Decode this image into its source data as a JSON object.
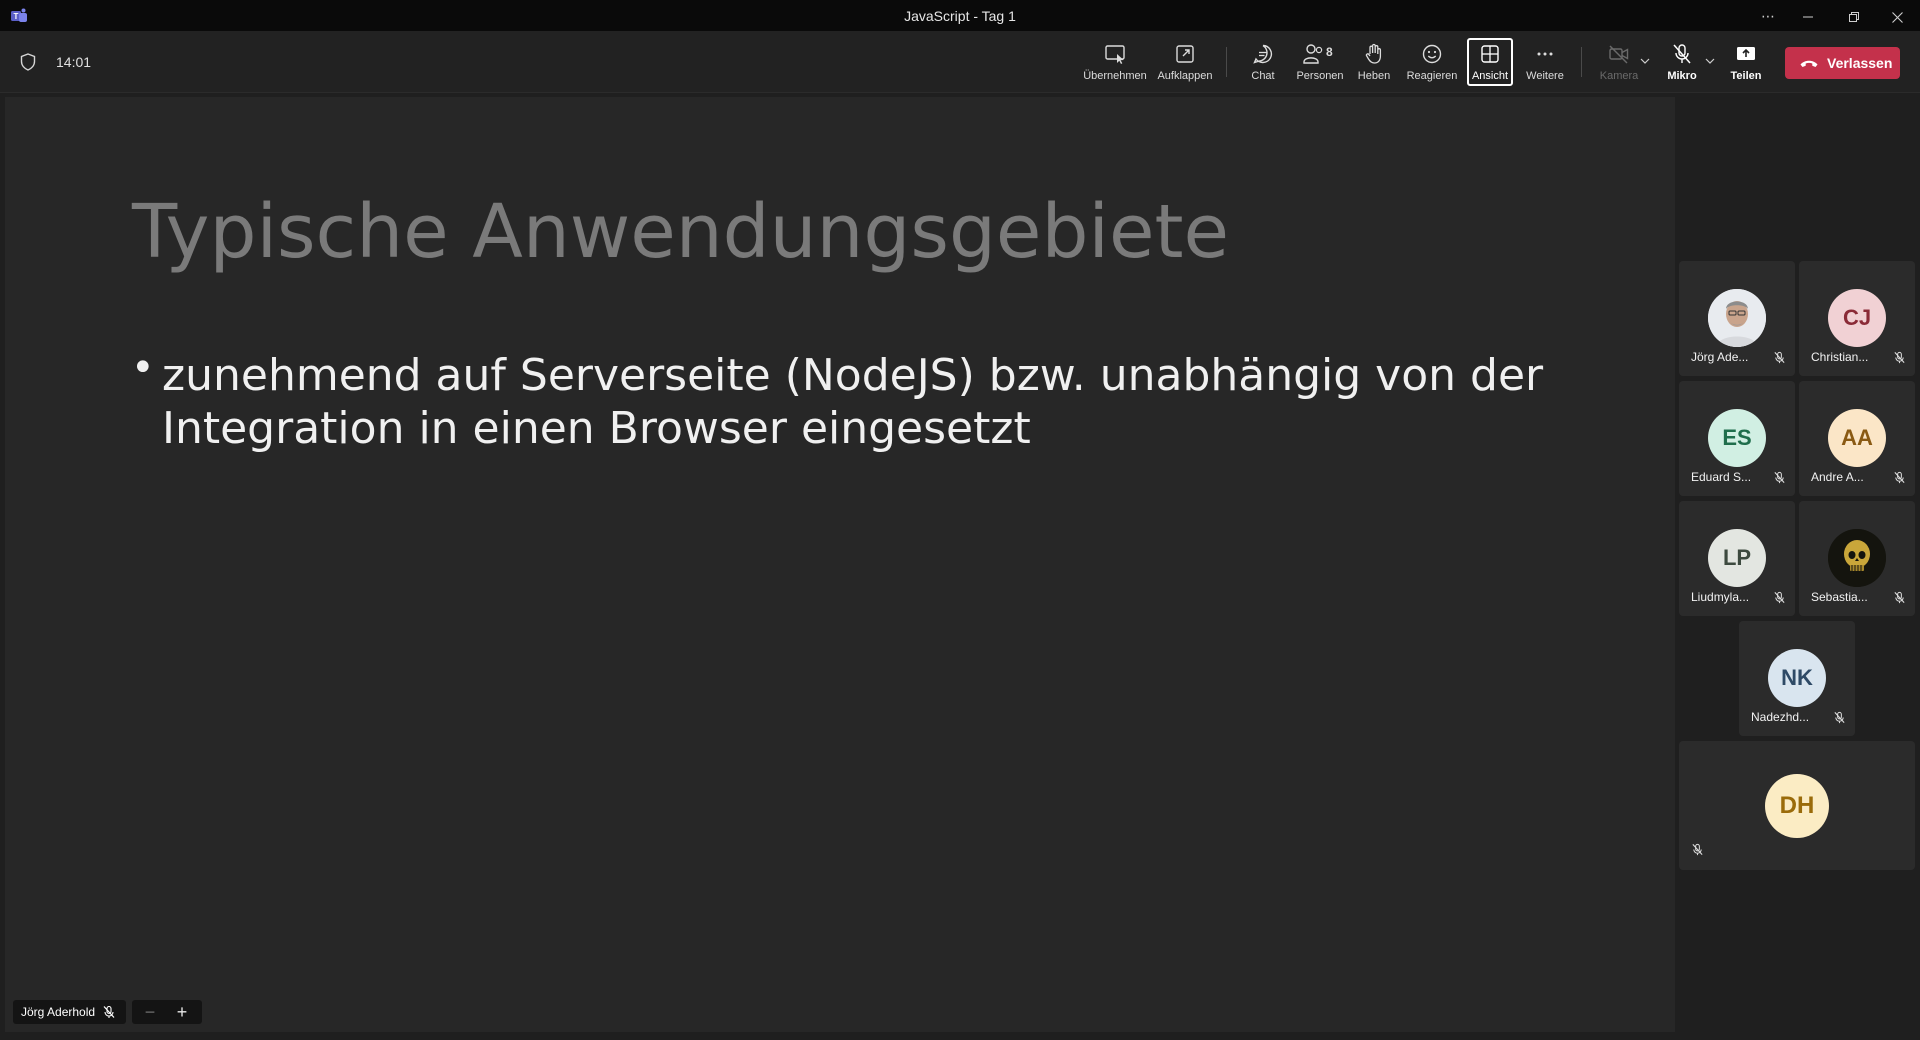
{
  "window": {
    "title": "JavaScript - Tag 1"
  },
  "toolbar": {
    "timer": "14:01",
    "buttons": {
      "uebernehmen": "Übernehmen",
      "aufklappen": "Aufklappen",
      "chat": "Chat",
      "personen": "Personen",
      "personen_count": "8",
      "heben": "Heben",
      "reagieren": "Reagieren",
      "ansicht": "Ansicht",
      "weitere": "Weitere",
      "kamera": "Kamera",
      "mikro": "Mikro",
      "teilen": "Teilen",
      "verlassen": "Verlassen"
    }
  },
  "slide": {
    "title": "Typische Anwendungsgebiete",
    "bullet_marker": "•",
    "bullets": [
      "zunehmend auf Serverseite (NodeJS) bzw. unabhängig von der Integration in einen Browser eingesetzt"
    ]
  },
  "stage": {
    "presenter_name": "Jörg Aderhold",
    "zoom_out": "−",
    "zoom_in": "+"
  },
  "participants": [
    {
      "name": "Jörg Ade...",
      "initials": "",
      "avatar_type": "photo-person",
      "avatar_bg": "#dfe3ea",
      "avatar_fg": "#333333"
    },
    {
      "name": "Christian...",
      "initials": "CJ",
      "avatar_bg": "#f1d1d4",
      "avatar_fg": "#8a2b37"
    },
    {
      "name": "Eduard S...",
      "initials": "ES",
      "avatar_bg": "#d1efe3",
      "avatar_fg": "#1f6e4c"
    },
    {
      "name": "Andre A...",
      "initials": "AA",
      "avatar_bg": "#fbe6c7",
      "avatar_fg": "#8a5a13"
    },
    {
      "name": "Liudmyla...",
      "initials": "LP",
      "avatar_bg": "#e3e6e1",
      "avatar_fg": "#3d4a3f"
    },
    {
      "name": "Sebastia...",
      "initials": "",
      "avatar_type": "photo-skull",
      "avatar_bg": "#1a1a12",
      "avatar_fg": "#c9a63a"
    },
    {
      "name": "Nadezhd...",
      "initials": "NK",
      "avatar_bg": "#d9e5ef",
      "avatar_fg": "#2e4a66"
    },
    {
      "name": "",
      "initials": "DH",
      "avatar_bg": "#fbecc4",
      "avatar_fg": "#9a6b0a"
    }
  ],
  "colors": {
    "leave_button": "#c4314b",
    "stage_bg": "#272727",
    "toolbar_bg": "#222222"
  }
}
